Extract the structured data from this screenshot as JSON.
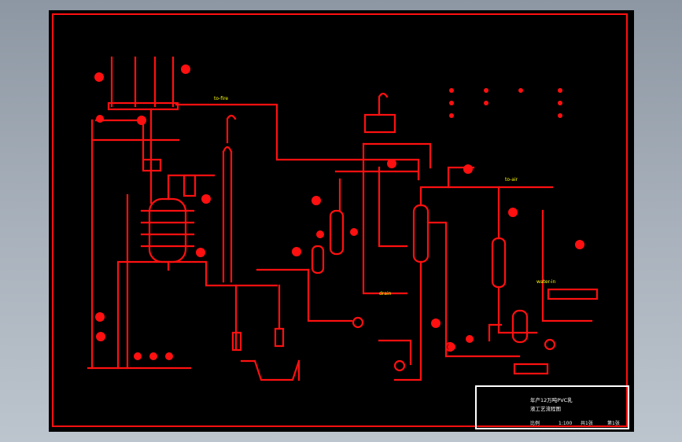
{
  "colors": {
    "pipe": "#ff1010",
    "text": "#ffff00",
    "border": "#ff1010",
    "titleblock": "#ffffff",
    "background": "#000000"
  },
  "line_labels": [
    {
      "id": "steam-to-fire",
      "text": "to-fire"
    },
    {
      "id": "exhaust",
      "text": "to-air"
    },
    {
      "id": "drain",
      "text": "drain"
    },
    {
      "id": "water-in",
      "text": "water-in"
    }
  ],
  "title_block": {
    "title_line1": "年产12万吨PVC乳",
    "title_line2": "液工艺流程图",
    "scale_label": "比例",
    "scale_value": "1:100",
    "sheet_label": "共1张",
    "sheet_no": "第1张"
  }
}
